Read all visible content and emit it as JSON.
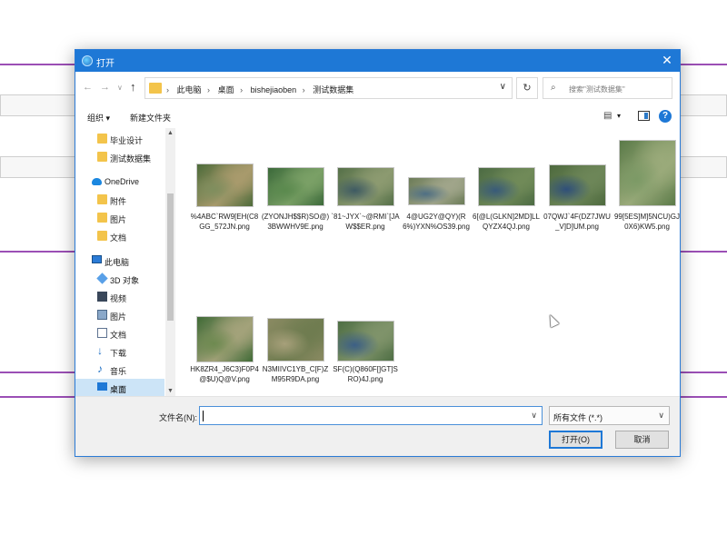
{
  "dialog": {
    "title": "打开",
    "close_glyph": "✕"
  },
  "address": {
    "breadcrumbs": [
      "此电脑",
      "桌面",
      "bishejiaoben",
      "测试数据集"
    ],
    "search_placeholder": "搜索\"测试数据集\""
  },
  "toolbar": {
    "organize_label": "组织 ▾",
    "new_folder_label": "新建文件夹"
  },
  "sidebar": {
    "items": [
      {
        "label": "毕业设计",
        "icon": "folder-icon"
      },
      {
        "label": "测试数据集",
        "icon": "folder-icon"
      },
      {
        "label": "OneDrive",
        "icon": "cloud-icon"
      },
      {
        "label": "附件",
        "icon": "folder-icon"
      },
      {
        "label": "图片",
        "icon": "folder-icon"
      },
      {
        "label": "文档",
        "icon": "folder-icon"
      },
      {
        "label": "此电脑",
        "icon": "computer-icon"
      },
      {
        "label": "3D 对象",
        "icon": "3d-objects-icon"
      },
      {
        "label": "视频",
        "icon": "video-icon"
      },
      {
        "label": "图片",
        "icon": "pictures-icon"
      },
      {
        "label": "文档",
        "icon": "documents-icon"
      },
      {
        "label": "下载",
        "icon": "download-icon"
      },
      {
        "label": "音乐",
        "icon": "music-icon"
      },
      {
        "label": "桌面",
        "icon": "desktop-icon"
      }
    ],
    "selected_item": "桌面"
  },
  "files": [
    {
      "name": "%4ABC`RW9[EH(C8GG_572JN.png",
      "colors": [
        "#4d6b3a",
        "#7f8e5e",
        "#a89a6c"
      ]
    },
    {
      "name": "(ZYONJH$$R)SO@)3BWWHV9E.png",
      "colors": [
        "#3c6a3a",
        "#5b8a4e",
        "#7aa066"
      ]
    },
    {
      "name": "`81~JYX`~@RMI`[JAW$$ER.png",
      "colors": [
        "#557048",
        "#3e5a63",
        "#8c9a70"
      ]
    },
    {
      "name": "4@UG2Y@QY)(R6%)YXN%OS39.png",
      "colors": [
        "#6c7c58",
        "#4f6f84",
        "#a0a58a"
      ]
    },
    {
      "name": "6[@L(GLKN]2MD]LLQYZX4QJ.png",
      "colors": [
        "#4c6b43",
        "#385a7a",
        "#708a58"
      ]
    },
    {
      "name": "07QWJ`4F(DZ7JWU_V]D]UM.png",
      "colors": [
        "#4e6a3e",
        "#2f4f7a",
        "#6d8658"
      ]
    },
    {
      "name": "99[5ES]M]5NCU)GJ0X6)KW5.png",
      "colors": [
        "#5a7a48",
        "#7c9a66",
        "#9aaa7a"
      ]
    },
    {
      "name": "HK8ZR4_J6C3)F0P4@$U)Q@V.png",
      "colors": [
        "#3f6a36",
        "#6e8a50",
        "#a3a27a"
      ]
    },
    {
      "name": "N3MIIVC1YB_C[F)ZM95R9DA.png",
      "colors": [
        "#8a8a62",
        "#a7a07a",
        "#6f7c50"
      ]
    },
    {
      "name": "SF(C)(Q860F[]GT]SRO)4J.png",
      "colors": [
        "#4e6e44",
        "#3c5f86",
        "#7f936a"
      ]
    }
  ],
  "bottom": {
    "filename_label": "文件名(N):",
    "filename_value": "",
    "filetype_value": "所有文件 (*.*)",
    "open_label": "打开(O)",
    "cancel_label": "取消"
  }
}
